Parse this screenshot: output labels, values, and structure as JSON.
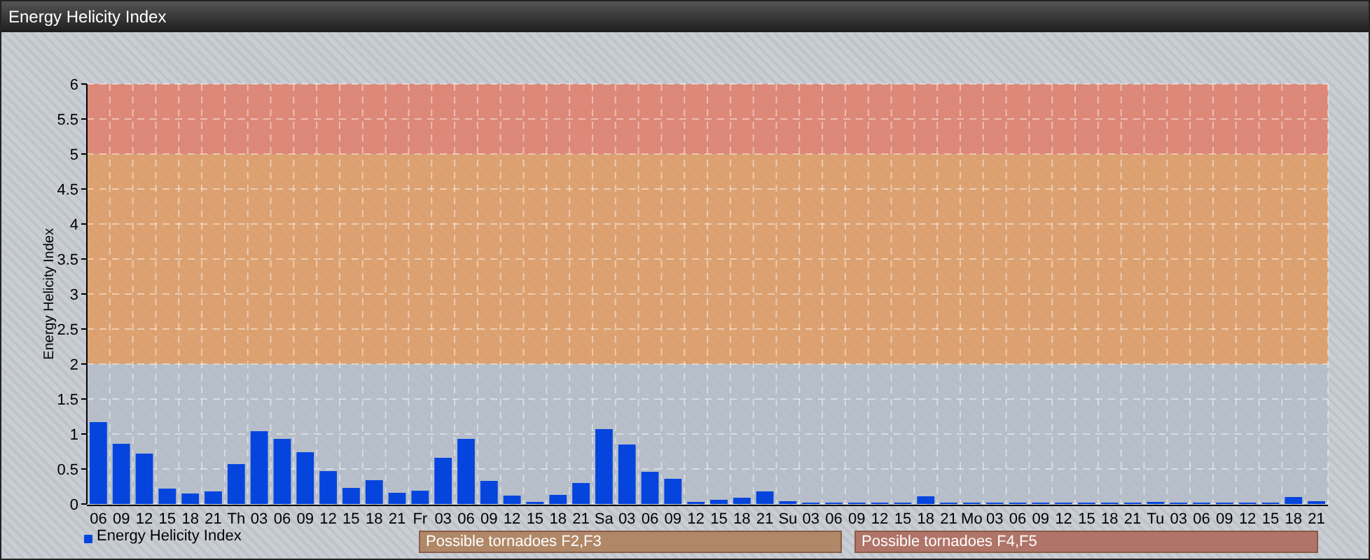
{
  "window": {
    "title": "Energy Helicity Index"
  },
  "chart": {
    "chart_data": {
      "type": "bar",
      "ylabel": "Energy Helicity Index",
      "ylim": [
        0,
        6
      ],
      "yticks": [
        0,
        0.5,
        1,
        1.5,
        2,
        2.5,
        3,
        3.5,
        4,
        4.5,
        5,
        5.5,
        6
      ],
      "grid": true,
      "categories": [
        "06",
        "09",
        "12",
        "15",
        "18",
        "21",
        "Th",
        "03",
        "06",
        "09",
        "12",
        "15",
        "18",
        "21",
        "Fr",
        "03",
        "06",
        "09",
        "12",
        "15",
        "18",
        "21",
        "Sa",
        "03",
        "06",
        "09",
        "12",
        "15",
        "18",
        "21",
        "Su",
        "03",
        "06",
        "09",
        "12",
        "15",
        "18",
        "21",
        "Mo",
        "03",
        "06",
        "09",
        "12",
        "15",
        "18",
        "21",
        "Tu",
        "03",
        "06",
        "09",
        "12",
        "15",
        "18",
        "21"
      ],
      "series": [
        {
          "name": "Energy Helicity Index",
          "color": "#0545dd",
          "values": [
            1.17,
            0.86,
            0.72,
            0.22,
            0.15,
            0.18,
            0.57,
            1.04,
            0.93,
            0.74,
            0.47,
            0.23,
            0.34,
            0.16,
            0.19,
            0.66,
            0.93,
            0.33,
            0.12,
            0.03,
            0.13,
            0.3,
            1.07,
            0.85,
            0.46,
            0.36,
            0.03,
            0.06,
            0.09,
            0.18,
            0.04,
            0.02,
            0.02,
            0.02,
            0.02,
            0.02,
            0.11,
            0.02,
            0.02,
            0.02,
            0.02,
            0.02,
            0.02,
            0.02,
            0.02,
            0.02,
            0.03,
            0.02,
            0.02,
            0.02,
            0.02,
            0.02,
            0.1,
            0.04
          ]
        }
      ],
      "bands": [
        {
          "axis": "y",
          "from": 0,
          "to": 2,
          "color": "#b4bcc8"
        },
        {
          "axis": "y",
          "from": 2,
          "to": 5,
          "color": "#e09a60"
        },
        {
          "axis": "y",
          "from": 5,
          "to": 6,
          "color": "#e07c68"
        }
      ]
    },
    "notes": [
      {
        "text": "Possible tornadoes F2,F3",
        "color": "#b08868"
      },
      {
        "text": "Possible tornadoes F4,F5",
        "color": "#b07468"
      }
    ]
  }
}
